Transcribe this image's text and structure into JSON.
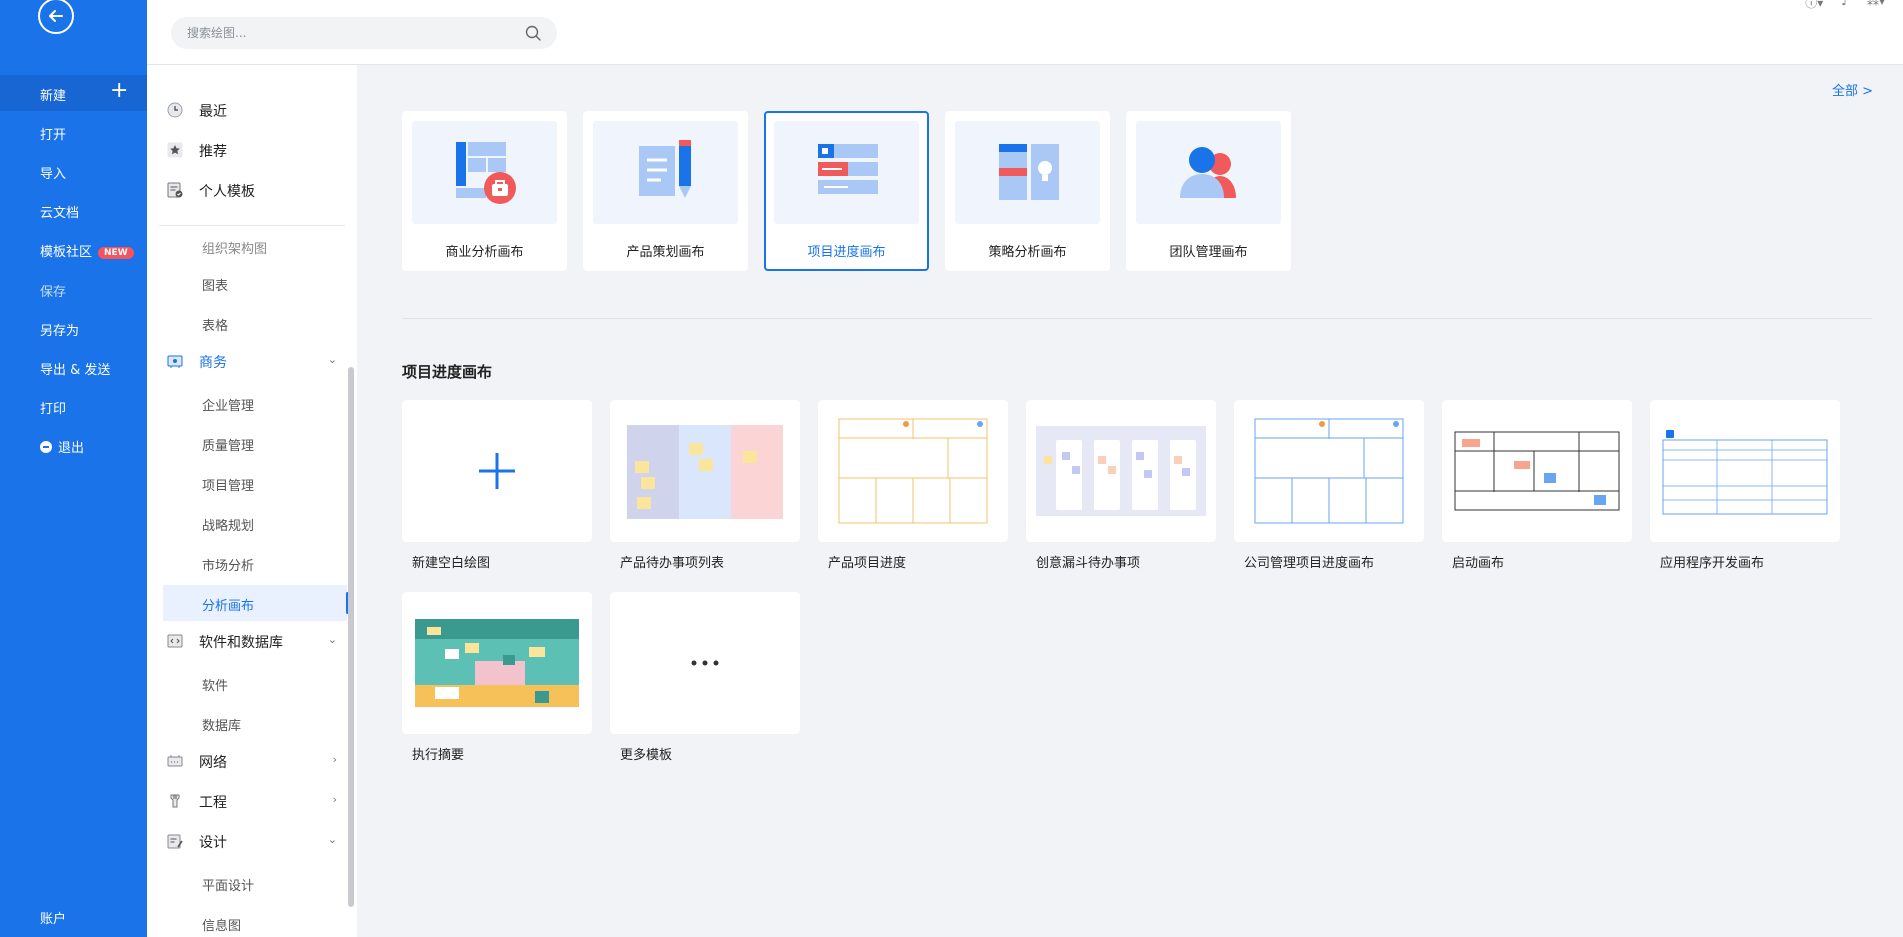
{
  "sidebar": {
    "new_label": "新建",
    "items": [
      {
        "label": "打开"
      },
      {
        "label": "导入"
      },
      {
        "label": "云文档"
      },
      {
        "label": "模板社区",
        "badge": "NEW"
      },
      {
        "label": "保存"
      },
      {
        "label": "另存为"
      },
      {
        "label": "导出 & 发送"
      },
      {
        "label": "打印"
      },
      {
        "label": "退出"
      }
    ],
    "account_label": "账户"
  },
  "search": {
    "placeholder": "搜索绘图..."
  },
  "categories": {
    "top": [
      {
        "label": "最近",
        "icon": "clock-icon"
      },
      {
        "label": "推荐",
        "icon": "star-icon"
      },
      {
        "label": "个人模板",
        "icon": "template-icon"
      }
    ],
    "partial_item": "组织架构图",
    "items": [
      {
        "label": "图表",
        "type": "sub"
      },
      {
        "label": "表格",
        "type": "sub"
      },
      {
        "label": "商务",
        "type": "group",
        "icon": "business-icon",
        "expanded": true,
        "active": true
      },
      {
        "label": "企业管理",
        "type": "sub"
      },
      {
        "label": "质量管理",
        "type": "sub"
      },
      {
        "label": "项目管理",
        "type": "sub"
      },
      {
        "label": "战略规划",
        "type": "sub"
      },
      {
        "label": "市场分析",
        "type": "sub"
      },
      {
        "label": "分析画布",
        "type": "sub",
        "selected": true
      },
      {
        "label": "软件和数据库",
        "type": "group",
        "icon": "code-icon",
        "expanded": true
      },
      {
        "label": "软件",
        "type": "sub"
      },
      {
        "label": "数据库",
        "type": "sub"
      },
      {
        "label": "网络",
        "type": "group",
        "icon": "network-icon",
        "expanded": false
      },
      {
        "label": "工程",
        "type": "group",
        "icon": "engineering-icon",
        "expanded": false
      },
      {
        "label": "设计",
        "type": "group",
        "icon": "design-icon",
        "expanded": true
      },
      {
        "label": "平面设计",
        "type": "sub"
      },
      {
        "label": "信息图",
        "type": "sub"
      }
    ]
  },
  "main": {
    "all_link": "全部 >",
    "canvases": [
      {
        "label": "商业分析画布"
      },
      {
        "label": "产品策划画布"
      },
      {
        "label": "项目进度画布",
        "selected": true
      },
      {
        "label": "策略分析画布"
      },
      {
        "label": "团队管理画布"
      }
    ],
    "section_title": "项目进度画布",
    "templates": [
      {
        "label": "新建空白绘图"
      },
      {
        "label": "产品待办事项列表"
      },
      {
        "label": "产品项目进度"
      },
      {
        "label": "创意漏斗待办事项"
      },
      {
        "label": "公司管理项目进度画布"
      },
      {
        "label": "启动画布"
      },
      {
        "label": "应用程序开发画布"
      },
      {
        "label": "执行摘要"
      },
      {
        "label": "更多模板"
      }
    ]
  },
  "colors": {
    "accent": "#1a73e8",
    "sidebar": "#1a73e8",
    "badge": "#f6545c"
  }
}
